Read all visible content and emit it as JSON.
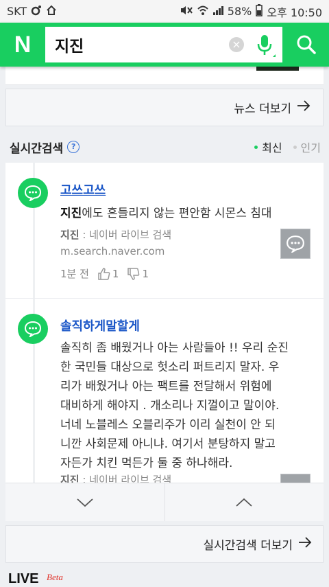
{
  "status_bar": {
    "carrier": "SKT",
    "battery": "58%",
    "time": "오후 10:50"
  },
  "search": {
    "logo": "N",
    "query": "지진",
    "clear_glyph": "×"
  },
  "news_more": {
    "label": "뉴스 더보기"
  },
  "realtime": {
    "title": "실시간검색",
    "help": "?",
    "sort_latest": "최신",
    "sort_popular": "인기"
  },
  "items": [
    {
      "title": "고쓰고쓰",
      "keyword": "지진",
      "body_rest": "에도 흔들리지 않는 편안함 시몬스 침대",
      "source_keyword": "지진",
      "source_rest": " : 네이버 라이브 검색",
      "url": "m.search.naver.com",
      "time": "1분 전",
      "likes": "1",
      "dislikes": "1"
    },
    {
      "title": "솔직하게말할게",
      "body_lines": [
        "솔직히 좀 배웠거나 아는 사람들아 !! 우리 순진",
        "한 국민들 대상으로 헛소리 퍼트리지 말자. 우",
        "리가 배웠거나 아는 팩트를 전달해서 위험에",
        "대비하게 해야지 . 개소리나 지껄이고 말이야.",
        "너네 노블레스 오블리주가 이리 실천이 안 되",
        "니깐 사회문제 아니냐. 여기서 분탕하지 말고",
        "자든가 치킨 먹든가 둘 중 하나해라."
      ],
      "source_keyword": "지진",
      "source_rest": " : 네이버 라이브 검색"
    }
  ],
  "realtime_more": {
    "label": "실시간검색 더보기"
  },
  "live": {
    "label": "LIVE",
    "beta": "Beta"
  },
  "colors": {
    "brand_green": "#19ce60",
    "link_blue": "#1a56c7"
  }
}
